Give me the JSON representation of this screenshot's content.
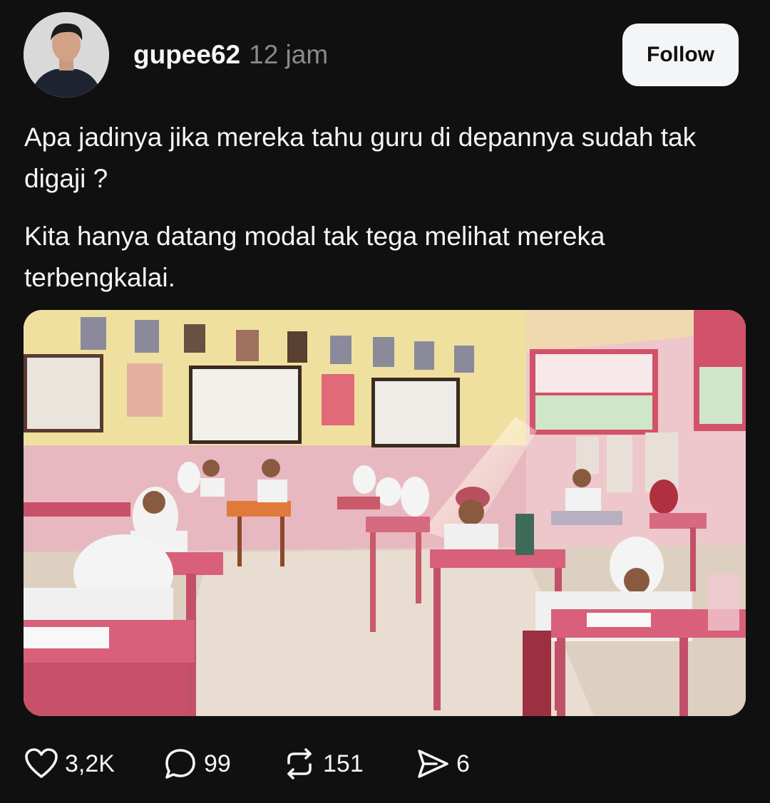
{
  "post": {
    "username": "gupee62",
    "time": "12 jam",
    "follow_label": "Follow",
    "text": [
      "Apa jadinya jika mereka tahu guru di depannya sudah tak digaji ?",
      "Kita hanya datang modal tak tega melihat mereka terbengkalai."
    ]
  },
  "actions": {
    "likes": "3,2K",
    "replies": "99",
    "reposts": "151",
    "shares": "6"
  },
  "icons": {
    "like": "heart-icon",
    "reply": "speech-bubble-icon",
    "repost": "repost-icon",
    "share": "send-icon"
  },
  "colors": {
    "background": "#101010",
    "text": "#f3f5f7",
    "muted": "#8a8a8a",
    "button_bg": "#f3f5f7"
  }
}
